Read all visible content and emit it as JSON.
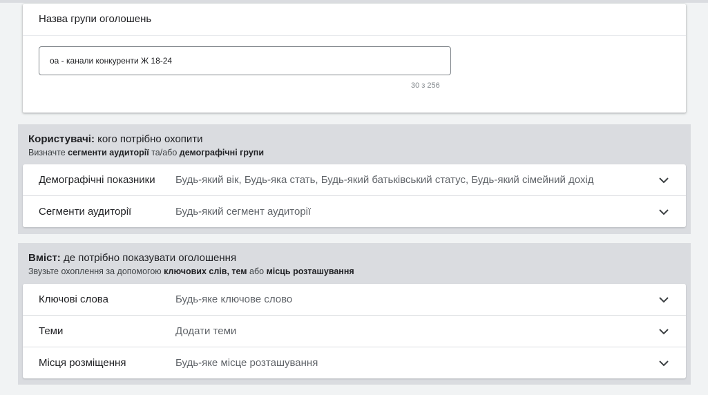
{
  "ad_group": {
    "title": "Назва групи оголошень",
    "name_value": "оа - канали конкуренти Ж 18-24",
    "char_counter": "30 з 256"
  },
  "users_section": {
    "heading_bold": "Користувачі:",
    "heading_rest": " кого потрібно охопити",
    "sub_prefix": "Визначте ",
    "sub_bold_1": "сегменти аудиторії",
    "sub_middle": " та/або ",
    "sub_bold_2": "демографічні групи",
    "rows": [
      {
        "label": "Демографічні показники",
        "value": "Будь-який вік, Будь-яка стать, Будь-який батьківський статус, Будь-який сімейний дохід"
      },
      {
        "label": "Сегменти аудиторії",
        "value": "Будь-який сегмент аудиторії"
      }
    ]
  },
  "content_section": {
    "heading_bold": "Вміст:",
    "heading_rest": " де потрібно показувати оголошення",
    "sub_prefix": "Звузьте охоплення за допомогою ",
    "sub_bold_1": "ключових слів",
    "sub_sep": ", ",
    "sub_bold_2": "тем",
    "sub_middle": " або ",
    "sub_bold_3": "місць розташування",
    "rows": [
      {
        "label": "Ключові слова",
        "value": "Будь-яке ключове слово"
      },
      {
        "label": "Теми",
        "value": "Додати теми"
      },
      {
        "label": "Місця розміщення",
        "value": "Будь-яке місце розташування"
      }
    ]
  },
  "icons": {
    "expand": "chevron-down-icon"
  }
}
